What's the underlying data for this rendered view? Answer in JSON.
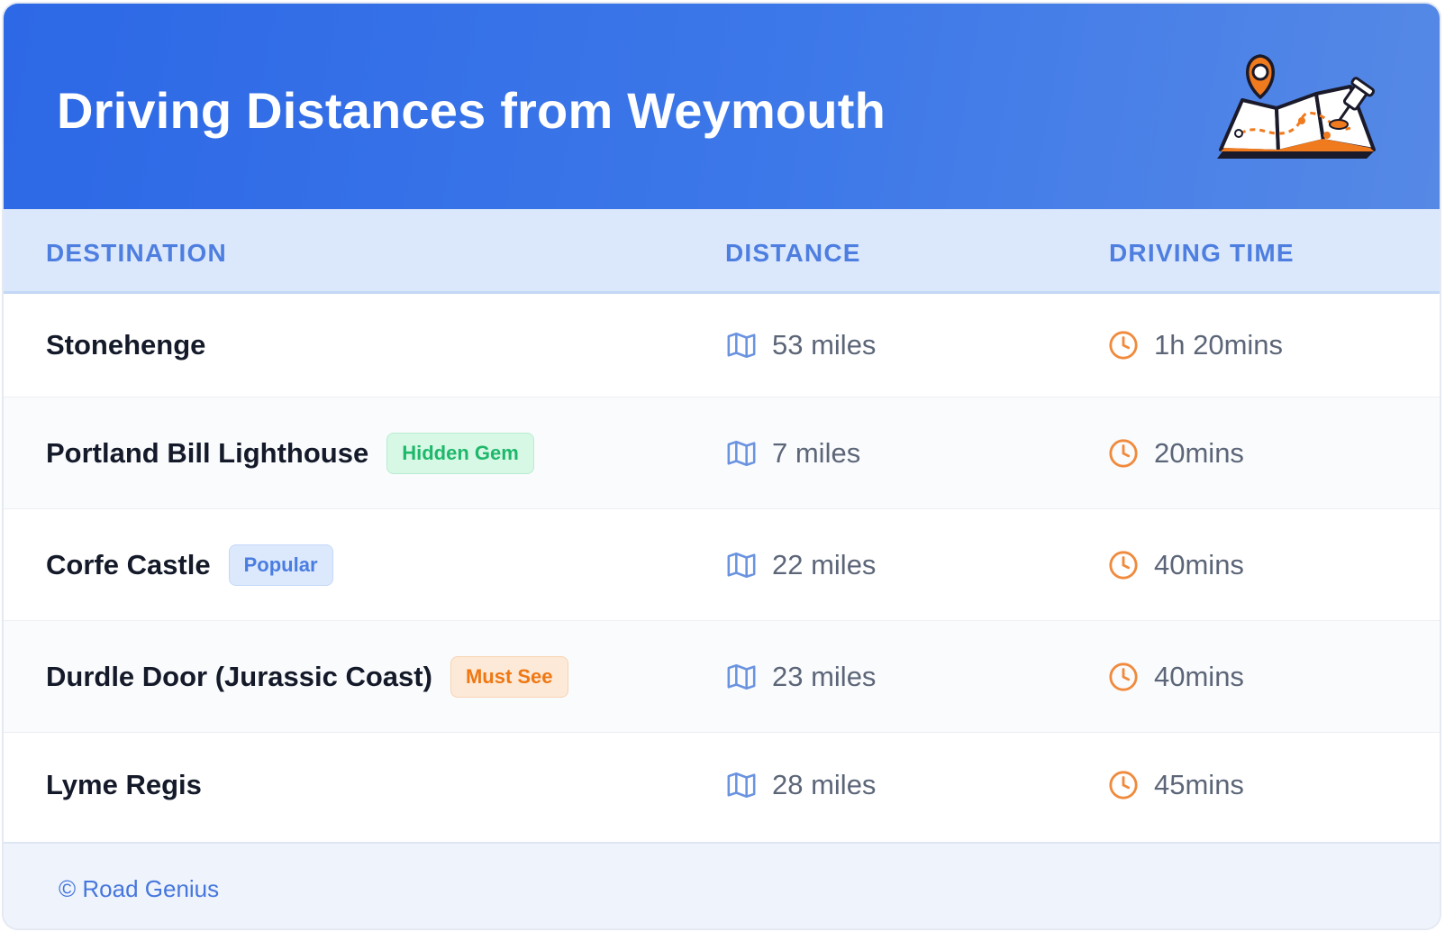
{
  "header": {
    "title": "Driving Distances from Weymouth",
    "illustration_icon": "folded-map-with-pin-icon"
  },
  "table": {
    "columns": [
      "DESTINATION",
      "DISTANCE",
      "DRIVING TIME"
    ],
    "distance_icon": "map-icon",
    "time_icon": "clock-icon",
    "rows": [
      {
        "destination": "Stonehenge",
        "badge": "",
        "distance": "53 miles",
        "time": "1h 20mins"
      },
      {
        "destination": "Portland Bill Lighthouse",
        "badge": "Hidden Gem",
        "badge_color": "#1eb86b",
        "distance": "7 miles",
        "time": "20mins"
      },
      {
        "destination": "Corfe Castle",
        "badge": "Popular",
        "badge_color": "#4a7de0",
        "distance": "22 miles",
        "time": "40mins"
      },
      {
        "destination": "Durdle Door (Jurassic Coast)",
        "badge": "Must See",
        "badge_color": "#ee7814",
        "distance": "23 miles",
        "time": "40mins"
      },
      {
        "destination": "Lyme Regis",
        "badge": "",
        "distance": "28 miles",
        "time": "45mins"
      }
    ]
  },
  "footer": {
    "credit": "© Road Genius"
  },
  "colors": {
    "header_start": "#2d68e6",
    "header_end": "#5689e6",
    "column_header_bg": "#dbe8fc",
    "column_header_text": "#4d7ee0",
    "map_icon": "#6a93e0",
    "clock_icon": "#f08a3c",
    "footer_bg": "#eef3fc"
  }
}
